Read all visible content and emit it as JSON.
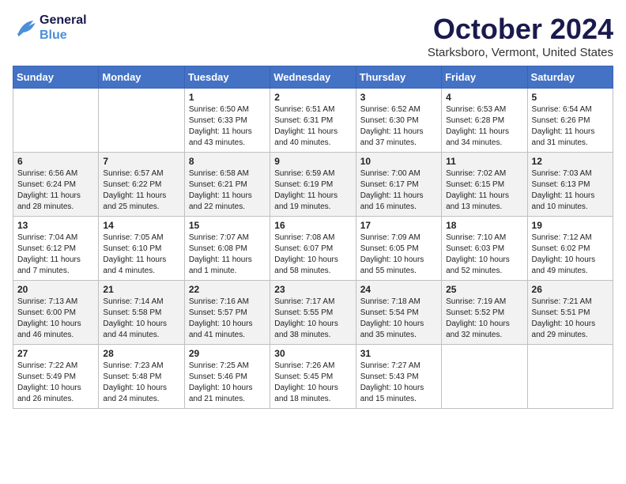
{
  "header": {
    "logo_line1": "General",
    "logo_line2": "Blue",
    "month": "October 2024",
    "location": "Starksboro, Vermont, United States"
  },
  "days_of_week": [
    "Sunday",
    "Monday",
    "Tuesday",
    "Wednesday",
    "Thursday",
    "Friday",
    "Saturday"
  ],
  "weeks": [
    [
      {
        "day": "",
        "sunrise": "",
        "sunset": "",
        "daylight": ""
      },
      {
        "day": "",
        "sunrise": "",
        "sunset": "",
        "daylight": ""
      },
      {
        "day": "1",
        "sunrise": "Sunrise: 6:50 AM",
        "sunset": "Sunset: 6:33 PM",
        "daylight": "Daylight: 11 hours and 43 minutes."
      },
      {
        "day": "2",
        "sunrise": "Sunrise: 6:51 AM",
        "sunset": "Sunset: 6:31 PM",
        "daylight": "Daylight: 11 hours and 40 minutes."
      },
      {
        "day": "3",
        "sunrise": "Sunrise: 6:52 AM",
        "sunset": "Sunset: 6:30 PM",
        "daylight": "Daylight: 11 hours and 37 minutes."
      },
      {
        "day": "4",
        "sunrise": "Sunrise: 6:53 AM",
        "sunset": "Sunset: 6:28 PM",
        "daylight": "Daylight: 11 hours and 34 minutes."
      },
      {
        "day": "5",
        "sunrise": "Sunrise: 6:54 AM",
        "sunset": "Sunset: 6:26 PM",
        "daylight": "Daylight: 11 hours and 31 minutes."
      }
    ],
    [
      {
        "day": "6",
        "sunrise": "Sunrise: 6:56 AM",
        "sunset": "Sunset: 6:24 PM",
        "daylight": "Daylight: 11 hours and 28 minutes."
      },
      {
        "day": "7",
        "sunrise": "Sunrise: 6:57 AM",
        "sunset": "Sunset: 6:22 PM",
        "daylight": "Daylight: 11 hours and 25 minutes."
      },
      {
        "day": "8",
        "sunrise": "Sunrise: 6:58 AM",
        "sunset": "Sunset: 6:21 PM",
        "daylight": "Daylight: 11 hours and 22 minutes."
      },
      {
        "day": "9",
        "sunrise": "Sunrise: 6:59 AM",
        "sunset": "Sunset: 6:19 PM",
        "daylight": "Daylight: 11 hours and 19 minutes."
      },
      {
        "day": "10",
        "sunrise": "Sunrise: 7:00 AM",
        "sunset": "Sunset: 6:17 PM",
        "daylight": "Daylight: 11 hours and 16 minutes."
      },
      {
        "day": "11",
        "sunrise": "Sunrise: 7:02 AM",
        "sunset": "Sunset: 6:15 PM",
        "daylight": "Daylight: 11 hours and 13 minutes."
      },
      {
        "day": "12",
        "sunrise": "Sunrise: 7:03 AM",
        "sunset": "Sunset: 6:13 PM",
        "daylight": "Daylight: 11 hours and 10 minutes."
      }
    ],
    [
      {
        "day": "13",
        "sunrise": "Sunrise: 7:04 AM",
        "sunset": "Sunset: 6:12 PM",
        "daylight": "Daylight: 11 hours and 7 minutes."
      },
      {
        "day": "14",
        "sunrise": "Sunrise: 7:05 AM",
        "sunset": "Sunset: 6:10 PM",
        "daylight": "Daylight: 11 hours and 4 minutes."
      },
      {
        "day": "15",
        "sunrise": "Sunrise: 7:07 AM",
        "sunset": "Sunset: 6:08 PM",
        "daylight": "Daylight: 11 hours and 1 minute."
      },
      {
        "day": "16",
        "sunrise": "Sunrise: 7:08 AM",
        "sunset": "Sunset: 6:07 PM",
        "daylight": "Daylight: 10 hours and 58 minutes."
      },
      {
        "day": "17",
        "sunrise": "Sunrise: 7:09 AM",
        "sunset": "Sunset: 6:05 PM",
        "daylight": "Daylight: 10 hours and 55 minutes."
      },
      {
        "day": "18",
        "sunrise": "Sunrise: 7:10 AM",
        "sunset": "Sunset: 6:03 PM",
        "daylight": "Daylight: 10 hours and 52 minutes."
      },
      {
        "day": "19",
        "sunrise": "Sunrise: 7:12 AM",
        "sunset": "Sunset: 6:02 PM",
        "daylight": "Daylight: 10 hours and 49 minutes."
      }
    ],
    [
      {
        "day": "20",
        "sunrise": "Sunrise: 7:13 AM",
        "sunset": "Sunset: 6:00 PM",
        "daylight": "Daylight: 10 hours and 46 minutes."
      },
      {
        "day": "21",
        "sunrise": "Sunrise: 7:14 AM",
        "sunset": "Sunset: 5:58 PM",
        "daylight": "Daylight: 10 hours and 44 minutes."
      },
      {
        "day": "22",
        "sunrise": "Sunrise: 7:16 AM",
        "sunset": "Sunset: 5:57 PM",
        "daylight": "Daylight: 10 hours and 41 minutes."
      },
      {
        "day": "23",
        "sunrise": "Sunrise: 7:17 AM",
        "sunset": "Sunset: 5:55 PM",
        "daylight": "Daylight: 10 hours and 38 minutes."
      },
      {
        "day": "24",
        "sunrise": "Sunrise: 7:18 AM",
        "sunset": "Sunset: 5:54 PM",
        "daylight": "Daylight: 10 hours and 35 minutes."
      },
      {
        "day": "25",
        "sunrise": "Sunrise: 7:19 AM",
        "sunset": "Sunset: 5:52 PM",
        "daylight": "Daylight: 10 hours and 32 minutes."
      },
      {
        "day": "26",
        "sunrise": "Sunrise: 7:21 AM",
        "sunset": "Sunset: 5:51 PM",
        "daylight": "Daylight: 10 hours and 29 minutes."
      }
    ],
    [
      {
        "day": "27",
        "sunrise": "Sunrise: 7:22 AM",
        "sunset": "Sunset: 5:49 PM",
        "daylight": "Daylight: 10 hours and 26 minutes."
      },
      {
        "day": "28",
        "sunrise": "Sunrise: 7:23 AM",
        "sunset": "Sunset: 5:48 PM",
        "daylight": "Daylight: 10 hours and 24 minutes."
      },
      {
        "day": "29",
        "sunrise": "Sunrise: 7:25 AM",
        "sunset": "Sunset: 5:46 PM",
        "daylight": "Daylight: 10 hours and 21 minutes."
      },
      {
        "day": "30",
        "sunrise": "Sunrise: 7:26 AM",
        "sunset": "Sunset: 5:45 PM",
        "daylight": "Daylight: 10 hours and 18 minutes."
      },
      {
        "day": "31",
        "sunrise": "Sunrise: 7:27 AM",
        "sunset": "Sunset: 5:43 PM",
        "daylight": "Daylight: 10 hours and 15 minutes."
      },
      {
        "day": "",
        "sunrise": "",
        "sunset": "",
        "daylight": ""
      },
      {
        "day": "",
        "sunrise": "",
        "sunset": "",
        "daylight": ""
      }
    ]
  ]
}
